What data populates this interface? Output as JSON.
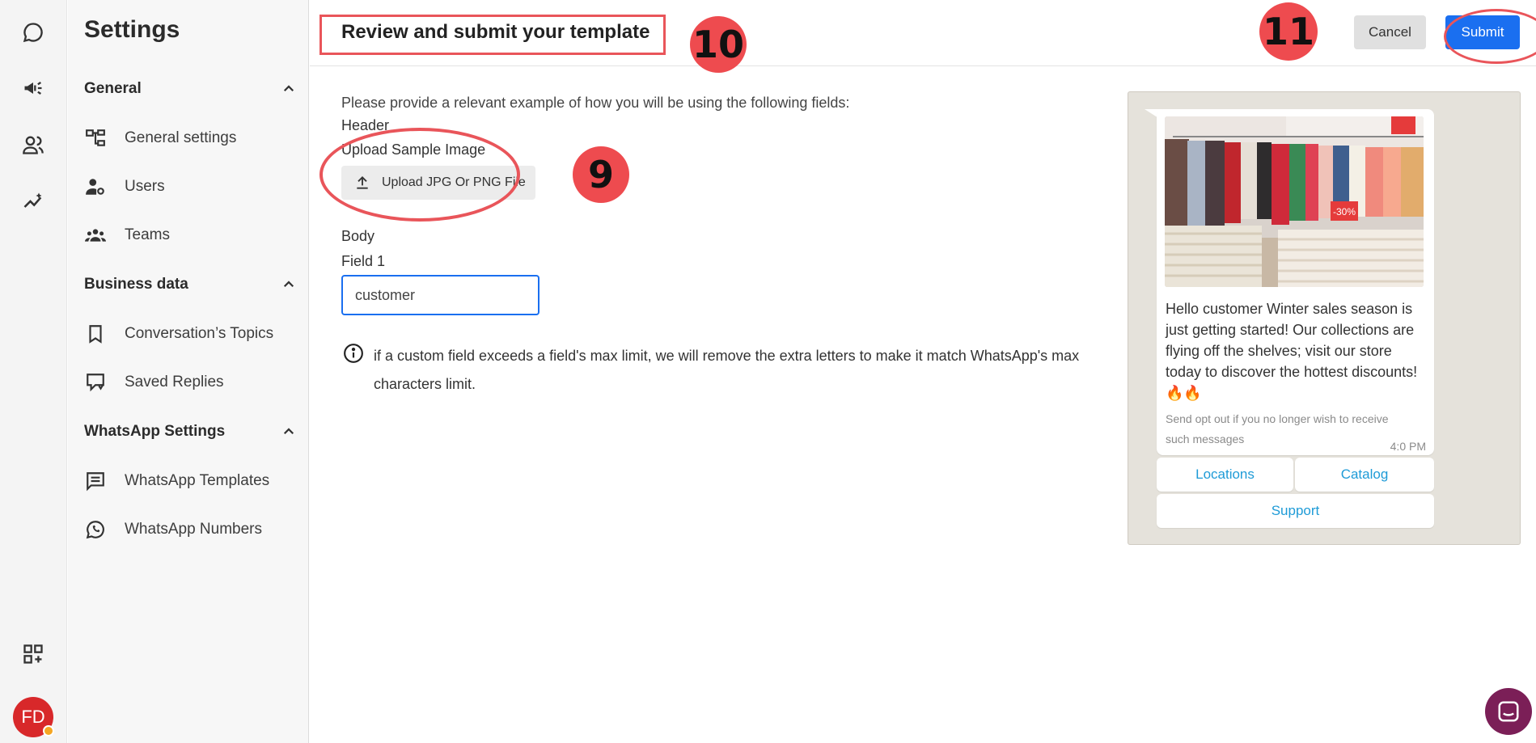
{
  "sidebar": {
    "title": "Settings",
    "sections": [
      {
        "label": "General",
        "items": [
          {
            "label": "General settings",
            "icon": "hierarchy-icon"
          },
          {
            "label": "Users",
            "icon": "user-gear-icon"
          },
          {
            "label": "Teams",
            "icon": "team-icon"
          }
        ]
      },
      {
        "label": "Business data",
        "items": [
          {
            "label": "Conversation’s Topics",
            "icon": "bookmark-icon"
          },
          {
            "label": "Saved Replies",
            "icon": "saved-reply-icon"
          }
        ]
      },
      {
        "label": "WhatsApp Settings",
        "items": [
          {
            "label": "WhatsApp Templates",
            "icon": "message-lines-icon"
          },
          {
            "label": "WhatsApp Numbers",
            "icon": "whatsapp-icon"
          }
        ]
      }
    ]
  },
  "rail": {
    "icons": [
      "chat-bubble-icon",
      "megaphone-icon",
      "contacts-icon",
      "analytics-icon",
      "apps-add-icon"
    ],
    "avatar_initials": "FD"
  },
  "header": {
    "title": "Review and submit your template",
    "cancel_label": "Cancel",
    "submit_label": "Submit"
  },
  "form": {
    "intro": "Please provide a relevant example of how you will be using the following fields:",
    "header_label": "Header",
    "upload_label": "Upload Sample Image",
    "upload_button": "Upload JPG Or PNG File",
    "body_label": "Body",
    "field1_label": "Field 1",
    "field1_value": "customer",
    "note": "if a custom field exceeds a field's max limit, we will remove the extra letters to make it match WhatsApp's max characters limit."
  },
  "annotations": {
    "badge_9": "9",
    "badge_10": "10",
    "badge_11": "11",
    "color": "#e9555a"
  },
  "preview": {
    "body": "Hello customer Winter sales season is just getting started! Our collections are flying off the shelves; visit our store today to discover the hottest discounts! 🔥🔥",
    "footer": "Send opt out if you no longer wish to receive such messages",
    "time": "4:0 PM",
    "image_tag": "-30%",
    "buttons": [
      "Locations",
      "Catalog",
      "Support"
    ]
  },
  "colors": {
    "primary": "#1a6ff0",
    "link": "#1e9bd7",
    "avatar": "#d8282a",
    "chat_fab": "#7b1f57"
  }
}
